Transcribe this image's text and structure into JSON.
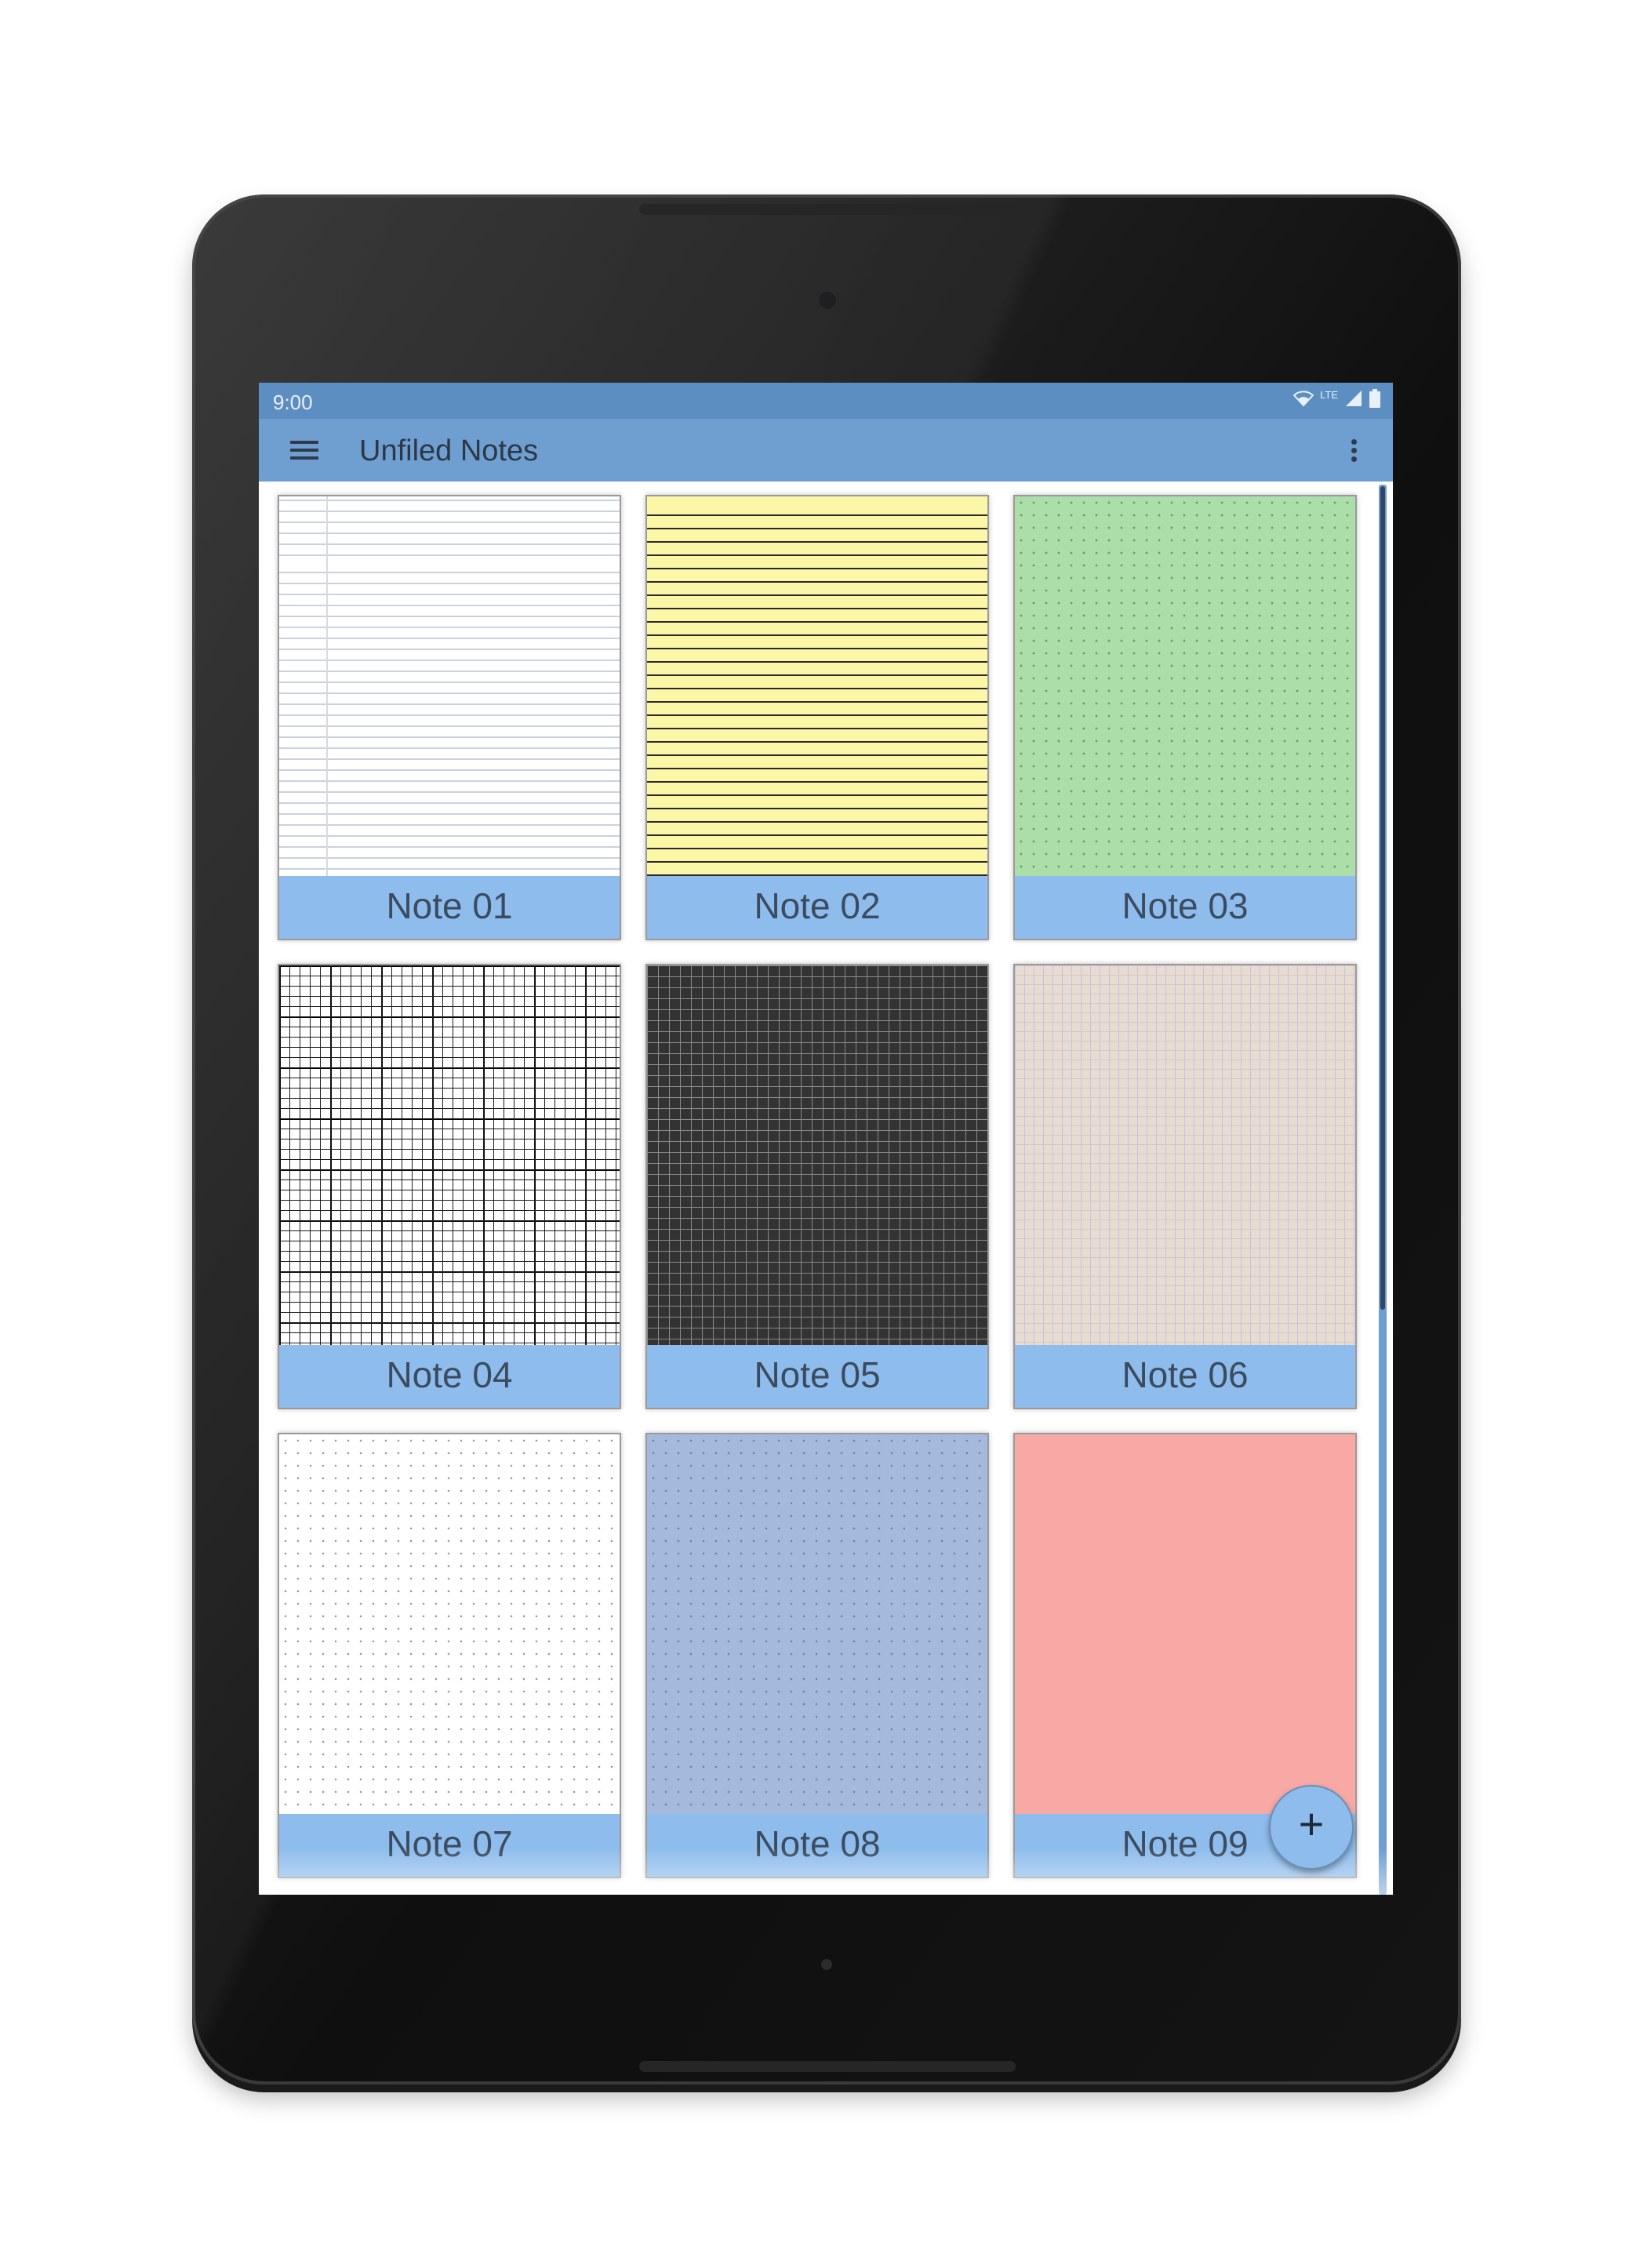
{
  "status_bar": {
    "time": "9:00",
    "network": "LTE",
    "icons": [
      "wifi-icon",
      "signal-icon",
      "battery-icon"
    ]
  },
  "app_bar": {
    "title": "Unfiled Notes",
    "menu_icon": "hamburger-menu-icon",
    "overflow_icon": "more-vert-icon"
  },
  "notes": [
    {
      "label": "Note 01",
      "paper": "white ruled lines",
      "color": "#ffffff"
    },
    {
      "label": "Note 02",
      "paper": "yellow ruled lines",
      "color": "#fbf7a6"
    },
    {
      "label": "Note 03",
      "paper": "green dot grid",
      "color": "#abdea8"
    },
    {
      "label": "Note 04",
      "paper": "white graph grid",
      "color": "#ffffff"
    },
    {
      "label": "Note 05",
      "paper": "dark graph grid",
      "color": "#333333"
    },
    {
      "label": "Note 06",
      "paper": "tan graph grid",
      "color": "#e6dcd2"
    },
    {
      "label": "Note 07",
      "paper": "white dot grid",
      "color": "#ffffff"
    },
    {
      "label": "Note 08",
      "paper": "blue dot grid",
      "color": "#a4b9dc"
    },
    {
      "label": "Note 09",
      "paper": "pink plain",
      "color": "#f9a9a5"
    }
  ],
  "fab": {
    "label": "+",
    "icon": "add-icon"
  },
  "colors": {
    "status_bar": "#5d8ec2",
    "app_bar": "#6f9ed1",
    "label_bar": "#8ebcec",
    "title_text": "#2c3846"
  }
}
